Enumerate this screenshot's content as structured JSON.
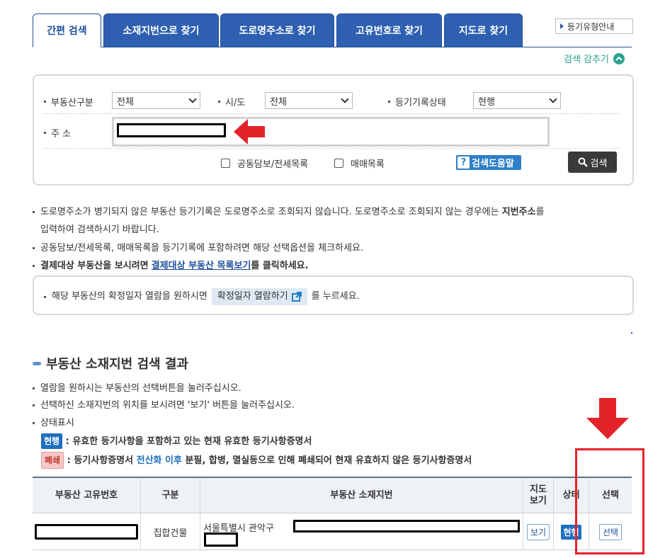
{
  "tabs": [
    {
      "label": "간편 검색"
    },
    {
      "label": "소재지번으로 찾기"
    },
    {
      "label": "도로명주소로 찾기"
    },
    {
      "label": "고유번호로 찾기"
    },
    {
      "label": "지도로 찾기"
    }
  ],
  "guide_button": "등기유형안내",
  "collapse_label": "검색 감추기",
  "collapse_icon": "chevron-up-icon",
  "search": {
    "property_type_label": "부동산구분",
    "property_type_value": "전체",
    "city_label": "시/도",
    "city_value": "전체",
    "record_status_label": "등기기록상태",
    "record_status_value": "현행",
    "address_label": "주 소",
    "joint_collateral_label": "공동담보/전세목록",
    "sale_list_label": "매매목록",
    "help_label": "검색도움말",
    "search_label": "검색"
  },
  "notes": {
    "n1_a": "도로명주소가 병기되지 않은 부동산 등기기록은 도로명주소로 조회되지 않습니다. 도로명주소로 조회되지 않는 경우에는",
    "n1_b": "지번주소",
    "n1_c": "를",
    "n1_d": "입력하여 검색하시기 바랍니다.",
    "n2": "공동담보/전세목록, 매매목록을 등기기록에 포함하려면 해당 선택옵션을 체크하세요.",
    "n3_a": "결제대상 부동산을 보시려면",
    "n3_link": "결제대상 부동산 목록보기",
    "n3_b": "를 클릭하세요."
  },
  "date_box": {
    "text_a": "해당 부동산의 확정일자 열람을 원하시면",
    "button": "확정일자 열람하기",
    "text_b": "를 누르세요."
  },
  "result": {
    "title": "부동산 소재지번 검색 결과",
    "r1": "열람을 원하시는 부동산의 선택버튼을 눌러주십시오.",
    "r2": "선택하신 소재지번의 위치를 보시려면 '보기' 버튼을 눌러주십시오.",
    "r3": "상태표시",
    "status_current_badge": "현행",
    "status_current_text": ": 유효한 등기사항을 포함하고 있는 현재 유효한 등기사항증명서",
    "status_closed_badge": "폐쇄",
    "status_closed_a": ": 등기사항증명서",
    "status_closed_highlight": "전산화 이후",
    "status_closed_b": "분필, 합병, 멸실등으로 인해 폐쇄되어 현재 유효하지 않은 등기사항증명서"
  },
  "table": {
    "headers": [
      "부동산 고유번호",
      "구분",
      "부동산 소재지번",
      "지도\n보기",
      "상태",
      "선택"
    ],
    "rows": [
      {
        "type": "집합건물",
        "address": "서울특별시 관악구",
        "view": "보기",
        "status": "현행",
        "select": "선택"
      }
    ]
  },
  "colors": {
    "tab_blue": "#2e5fb0",
    "accent_teal": "#2aa18e",
    "annotation_red": "#e3222a"
  }
}
